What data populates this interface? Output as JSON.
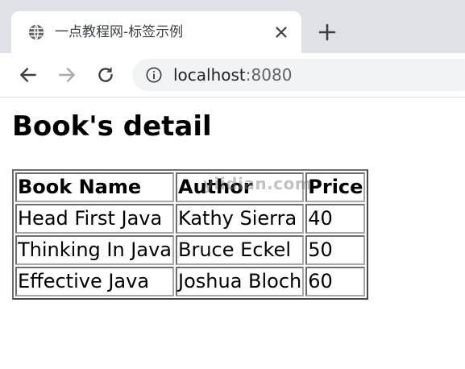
{
  "browser": {
    "tab": {
      "title": "一点教程网-标签示例",
      "favicon": "globe-icon",
      "close_icon": "close-icon"
    },
    "new_tab_icon": "plus-icon",
    "toolbar": {
      "back_icon": "arrow-left-icon",
      "forward_icon": "arrow-right-icon",
      "reload_icon": "reload-icon",
      "info_icon": "info-icon"
    },
    "url": {
      "host": "localhost",
      "port": ":8080"
    }
  },
  "page": {
    "title": "Book's detail",
    "watermark": "yiidian.com",
    "table": {
      "headers": [
        "Book Name",
        "Author",
        "Price"
      ],
      "rows": [
        [
          "Head First Java",
          "Kathy Sierra",
          "40"
        ],
        [
          "Thinking In Java",
          "Bruce Eckel",
          "50"
        ],
        [
          "Effective Java",
          "Joshua Bloch",
          "60"
        ]
      ]
    }
  }
}
